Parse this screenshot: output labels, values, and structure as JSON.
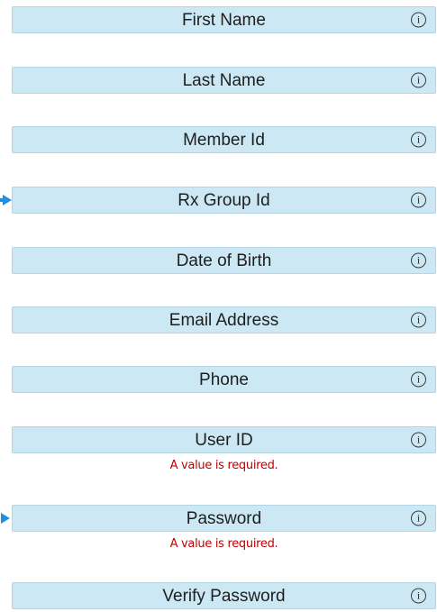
{
  "fields": [
    {
      "label": "First Name"
    },
    {
      "label": "Last Name"
    },
    {
      "label": "Member Id"
    },
    {
      "label": "Rx Group Id"
    },
    {
      "label": "Date of Birth"
    },
    {
      "label": "Email Address"
    },
    {
      "label": "Phone"
    },
    {
      "label": "User ID",
      "error": "A value is required."
    },
    {
      "label": "Password",
      "error": "A value is required."
    },
    {
      "label": "Verify Password"
    }
  ],
  "info_glyph": "i",
  "icons": {
    "info": "info-circle-icon",
    "pointer": "arrow-right-icon"
  },
  "colors": {
    "field_background": "#cce8f4",
    "error_text": "#c00000",
    "pointer_arrow": "#1f8fe0"
  }
}
